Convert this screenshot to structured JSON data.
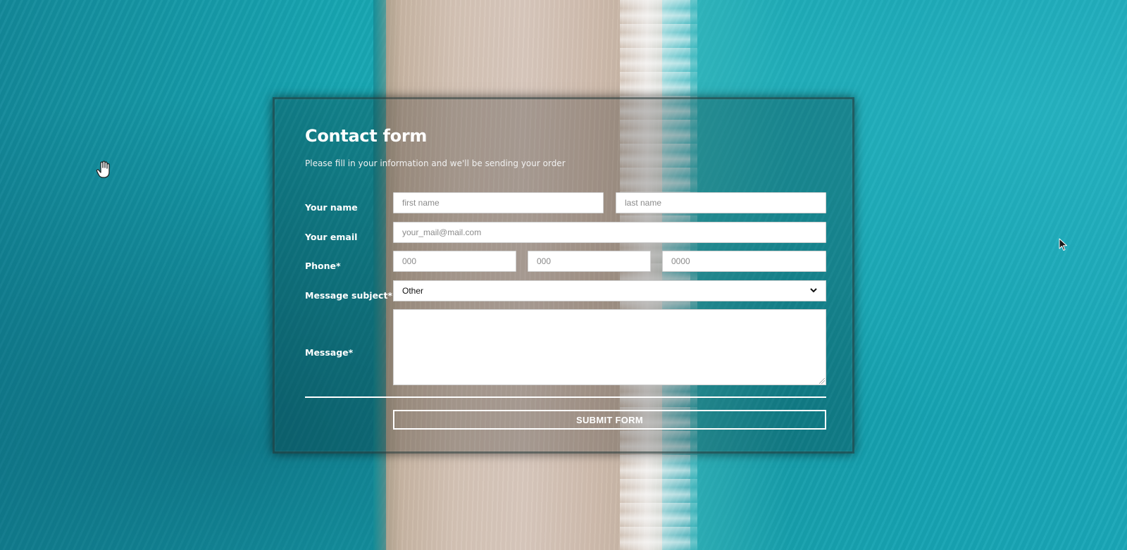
{
  "form": {
    "title": "Contact form",
    "subtitle": "Please fill in your information and we'll be sending your order",
    "name_label": "Your name",
    "first_name_placeholder": "first name",
    "last_name_placeholder": "last name",
    "email_label": "Your email",
    "email_placeholder": "your_mail@mail.com",
    "phone_label": "Phone*",
    "phone_part1_placeholder": "000",
    "phone_part2_placeholder": "000",
    "phone_part3_placeholder": "0000",
    "subject_label": "Message subject*",
    "subject_selected": "Other",
    "message_label": "Message*",
    "submit_label": "SUBMIT FORM"
  },
  "icons": {
    "select_arrow": "chevron-down-icon",
    "hand_cursor": "hand-cursor-icon",
    "arrow_cursor": "arrow-cursor-icon",
    "textarea_resize": "resize-handle-icon"
  },
  "colors": {
    "text": "#ffffff",
    "field_background": "#ffffff",
    "placeholder": "#8a8a8a"
  }
}
